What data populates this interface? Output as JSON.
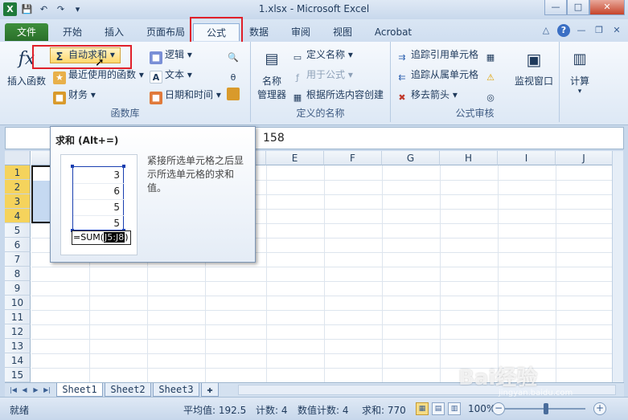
{
  "window": {
    "title": "1.xlsx - Microsoft Excel",
    "minimize": "—",
    "restore": "□",
    "close": "✕"
  },
  "tabs": {
    "file": "文件",
    "home": "开始",
    "insert": "插入",
    "page_layout": "页面布局",
    "formulas": "公式",
    "data": "数据",
    "review": "审阅",
    "view": "视图",
    "acrobat": "Acrobat"
  },
  "ribbon": {
    "function_library": {
      "label": "函数库",
      "insert_function": "插入函数",
      "autosum": "自动求和",
      "recent": "最近使用的函数",
      "financial": "财务",
      "logical": "逻辑",
      "text": "文本",
      "date_time": "日期和时间"
    },
    "defined_names": {
      "label": "定义的名称",
      "name_manager_1": "名称",
      "name_manager_2": "管理器",
      "define_name": "定义名称",
      "use_in_formula": "用于公式",
      "create_from_selection": "根据所选内容创建"
    },
    "formula_auditing": {
      "label": "公式审核",
      "trace_precedents": "追踪引用单元格",
      "trace_dependents": "追踪从属单元格",
      "remove_arrows": "移去箭头",
      "watch_window": "监视窗口"
    },
    "calculation": {
      "label": "计算"
    }
  },
  "formula_bar": {
    "value": "158"
  },
  "tooltip": {
    "title": "求和 (Alt+=)",
    "description": "紧接所选单元格之后显示所选单元格的求和值。",
    "values": [
      "3",
      "6",
      "5",
      "5"
    ],
    "formula_prefix": "=SUM(",
    "formula_ref": "J5:J8",
    "formula_suffix": ")"
  },
  "grid": {
    "columns": [
      "E",
      "F",
      "G",
      "H",
      "I",
      "J"
    ],
    "rows": [
      "1",
      "2",
      "3",
      "4",
      "5",
      "6",
      "7",
      "8",
      "9",
      "10",
      "11",
      "12",
      "13",
      "14",
      "15"
    ]
  },
  "sheets": [
    "Sheet1",
    "Sheet2",
    "Sheet3"
  ],
  "status": {
    "mode": "就绪",
    "average": "平均值: 192.5",
    "count": "计数: 4",
    "numeric_count": "数值计数: 4",
    "sum": "求和: 770",
    "zoom": "100%"
  },
  "watermark": {
    "main": "Bai经验",
    "sub": "jingyan.baidu.com"
  },
  "colors": {
    "accent_red": "#e0202a",
    "file_tab": "#2a6f2a",
    "selected_row": "#f5d35c"
  }
}
